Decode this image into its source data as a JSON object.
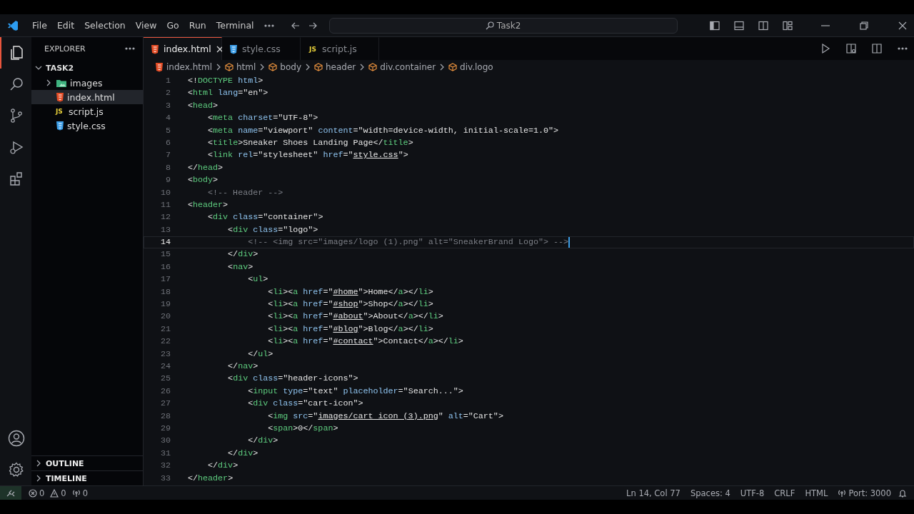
{
  "title_bar": {
    "menu": [
      "File",
      "Edit",
      "Selection",
      "View",
      "Go",
      "Run",
      "Terminal"
    ],
    "search": {
      "value": "Task2"
    }
  },
  "activity_bar": [
    {
      "kind": "files",
      "selected": true
    },
    {
      "kind": "search",
      "selected": false
    },
    {
      "kind": "source-control",
      "selected": false
    },
    {
      "kind": "run",
      "selected": false
    },
    {
      "kind": "extensions",
      "selected": false
    }
  ],
  "sidebar": {
    "title": "EXPLORER",
    "folder": {
      "label": "TASK2",
      "expanded": true
    },
    "items": [
      {
        "label": "images",
        "kind": "folder",
        "expanded": false,
        "selected": false
      },
      {
        "label": "index.html",
        "kind": "html",
        "selected": true
      },
      {
        "label": "script.js",
        "kind": "js",
        "icon_text": "JS",
        "selected": false
      },
      {
        "label": "style.css",
        "kind": "css",
        "selected": false
      }
    ],
    "sections": [
      "OUTLINE",
      "TIMELINE"
    ]
  },
  "tabs": [
    {
      "label": "index.html",
      "kind": "html",
      "selected": true
    },
    {
      "label": "style.css",
      "kind": "css",
      "selected": false
    },
    {
      "label": "script.js",
      "kind": "js",
      "icon_text": "JS",
      "selected": false
    }
  ],
  "breadcrumbs": [
    {
      "label": "index.html",
      "kind": "file"
    },
    {
      "label": "html",
      "kind": "element"
    },
    {
      "label": "body",
      "kind": "element"
    },
    {
      "label": "header",
      "kind": "element"
    },
    {
      "label": "div.container",
      "kind": "element"
    },
    {
      "label": "div.logo",
      "kind": "element"
    }
  ],
  "code": [
    {
      "number": "1",
      "current": false,
      "tokens": [
        {
          "kind": "plain",
          "text": "<!"
        },
        {
          "kind": "tag",
          "text": "DOCTYPE "
        },
        {
          "kind": "attr",
          "text": "html"
        },
        {
          "kind": "plain",
          "text": ">"
        }
      ]
    },
    {
      "number": "2",
      "current": false,
      "tokens": [
        {
          "kind": "plain",
          "text": "<"
        },
        {
          "kind": "tag",
          "text": "html "
        },
        {
          "kind": "attr",
          "text": "lang"
        },
        {
          "kind": "plain",
          "text": "=\"en\">"
        }
      ]
    },
    {
      "number": "3",
      "current": false,
      "tokens": [
        {
          "kind": "plain",
          "text": "<"
        },
        {
          "kind": "tag",
          "text": "head"
        },
        {
          "kind": "plain",
          "text": ">"
        }
      ]
    },
    {
      "number": "4",
      "current": false,
      "tokens": [
        {
          "kind": "plain",
          "text": "    <"
        },
        {
          "kind": "tag",
          "text": "meta "
        },
        {
          "kind": "attr",
          "text": "charset"
        },
        {
          "kind": "plain",
          "text": "=\"UTF-8\">"
        }
      ]
    },
    {
      "number": "5",
      "current": false,
      "tokens": [
        {
          "kind": "plain",
          "text": "    <"
        },
        {
          "kind": "tag",
          "text": "meta "
        },
        {
          "kind": "attr",
          "text": "name"
        },
        {
          "kind": "plain",
          "text": "=\"viewport\" "
        },
        {
          "kind": "attr",
          "text": "content"
        },
        {
          "kind": "plain",
          "text": "=\"width=device-width, initial-scale=1.0\">"
        }
      ]
    },
    {
      "number": "6",
      "current": false,
      "tokens": [
        {
          "kind": "plain",
          "text": "    <"
        },
        {
          "kind": "tag",
          "text": "title"
        },
        {
          "kind": "plain",
          "text": ">Sneaker Shoes Landing Page</"
        },
        {
          "kind": "tag",
          "text": "title"
        },
        {
          "kind": "plain",
          "text": ">"
        }
      ]
    },
    {
      "number": "7",
      "current": false,
      "tokens": [
        {
          "kind": "plain",
          "text": "    <"
        },
        {
          "kind": "tag",
          "text": "link "
        },
        {
          "kind": "attr",
          "text": "rel"
        },
        {
          "kind": "plain",
          "text": "=\"stylesheet\" "
        },
        {
          "kind": "attr",
          "text": "href"
        },
        {
          "kind": "plain",
          "text": "=\""
        },
        {
          "kind": "link",
          "text": "style.css"
        },
        {
          "kind": "plain",
          "text": "\">"
        }
      ]
    },
    {
      "number": "8",
      "current": false,
      "tokens": [
        {
          "kind": "plain",
          "text": "</"
        },
        {
          "kind": "tag",
          "text": "head"
        },
        {
          "kind": "plain",
          "text": ">"
        }
      ]
    },
    {
      "number": "9",
      "current": false,
      "tokens": [
        {
          "kind": "plain",
          "text": "<"
        },
        {
          "kind": "tag",
          "text": "body"
        },
        {
          "kind": "plain",
          "text": ">"
        }
      ]
    },
    {
      "number": "10",
      "current": false,
      "tokens": [
        {
          "kind": "comment",
          "text": "    <!-- Header -->"
        }
      ]
    },
    {
      "number": "11",
      "current": false,
      "tokens": [
        {
          "kind": "plain",
          "text": "<"
        },
        {
          "kind": "tag",
          "text": "header"
        },
        {
          "kind": "plain",
          "text": ">"
        }
      ]
    },
    {
      "number": "12",
      "current": false,
      "tokens": [
        {
          "kind": "plain",
          "text": "    <"
        },
        {
          "kind": "tag",
          "text": "div "
        },
        {
          "kind": "attr",
          "text": "class"
        },
        {
          "kind": "plain",
          "text": "=\"container\">"
        }
      ]
    },
    {
      "number": "13",
      "current": false,
      "tokens": [
        {
          "kind": "plain",
          "text": "        <"
        },
        {
          "kind": "tag",
          "text": "div "
        },
        {
          "kind": "attr",
          "text": "class"
        },
        {
          "kind": "plain",
          "text": "=\"logo\">"
        }
      ]
    },
    {
      "number": "14",
      "current": true,
      "tokens": [
        {
          "kind": "comment",
          "text": "            <!-- <img src=\"images/logo (1).png\" alt=\"SneakerBrand Logo\"> -->"
        }
      ]
    },
    {
      "number": "15",
      "current": false,
      "tokens": [
        {
          "kind": "plain",
          "text": "        </"
        },
        {
          "kind": "tag",
          "text": "div"
        },
        {
          "kind": "plain",
          "text": ">"
        }
      ]
    },
    {
      "number": "16",
      "current": false,
      "tokens": [
        {
          "kind": "plain",
          "text": "        <"
        },
        {
          "kind": "tag",
          "text": "nav"
        },
        {
          "kind": "plain",
          "text": ">"
        }
      ]
    },
    {
      "number": "17",
      "current": false,
      "tokens": [
        {
          "kind": "plain",
          "text": "            <"
        },
        {
          "kind": "tag",
          "text": "ul"
        },
        {
          "kind": "plain",
          "text": ">"
        }
      ]
    },
    {
      "number": "18",
      "current": false,
      "tokens": [
        {
          "kind": "plain",
          "text": "                <"
        },
        {
          "kind": "tag",
          "text": "li"
        },
        {
          "kind": "plain",
          "text": "><"
        },
        {
          "kind": "tag",
          "text": "a "
        },
        {
          "kind": "attr",
          "text": "href"
        },
        {
          "kind": "plain",
          "text": "=\""
        },
        {
          "kind": "link",
          "text": "#home"
        },
        {
          "kind": "plain",
          "text": "\">Home</"
        },
        {
          "kind": "tag",
          "text": "a"
        },
        {
          "kind": "plain",
          "text": "></"
        },
        {
          "kind": "tag",
          "text": "li"
        },
        {
          "kind": "plain",
          "text": ">"
        }
      ]
    },
    {
      "number": "19",
      "current": false,
      "tokens": [
        {
          "kind": "plain",
          "text": "                <"
        },
        {
          "kind": "tag",
          "text": "li"
        },
        {
          "kind": "plain",
          "text": "><"
        },
        {
          "kind": "tag",
          "text": "a "
        },
        {
          "kind": "attr",
          "text": "href"
        },
        {
          "kind": "plain",
          "text": "=\""
        },
        {
          "kind": "link",
          "text": "#shop"
        },
        {
          "kind": "plain",
          "text": "\">Shop</"
        },
        {
          "kind": "tag",
          "text": "a"
        },
        {
          "kind": "plain",
          "text": "></"
        },
        {
          "kind": "tag",
          "text": "li"
        },
        {
          "kind": "plain",
          "text": ">"
        }
      ]
    },
    {
      "number": "20",
      "current": false,
      "tokens": [
        {
          "kind": "plain",
          "text": "                <"
        },
        {
          "kind": "tag",
          "text": "li"
        },
        {
          "kind": "plain",
          "text": "><"
        },
        {
          "kind": "tag",
          "text": "a "
        },
        {
          "kind": "attr",
          "text": "href"
        },
        {
          "kind": "plain",
          "text": "=\""
        },
        {
          "kind": "link",
          "text": "#about"
        },
        {
          "kind": "plain",
          "text": "\">About</"
        },
        {
          "kind": "tag",
          "text": "a"
        },
        {
          "kind": "plain",
          "text": "></"
        },
        {
          "kind": "tag",
          "text": "li"
        },
        {
          "kind": "plain",
          "text": ">"
        }
      ]
    },
    {
      "number": "21",
      "current": false,
      "tokens": [
        {
          "kind": "plain",
          "text": "                <"
        },
        {
          "kind": "tag",
          "text": "li"
        },
        {
          "kind": "plain",
          "text": "><"
        },
        {
          "kind": "tag",
          "text": "a "
        },
        {
          "kind": "attr",
          "text": "href"
        },
        {
          "kind": "plain",
          "text": "=\""
        },
        {
          "kind": "link",
          "text": "#blog"
        },
        {
          "kind": "plain",
          "text": "\">Blog</"
        },
        {
          "kind": "tag",
          "text": "a"
        },
        {
          "kind": "plain",
          "text": "></"
        },
        {
          "kind": "tag",
          "text": "li"
        },
        {
          "kind": "plain",
          "text": ">"
        }
      ]
    },
    {
      "number": "22",
      "current": false,
      "tokens": [
        {
          "kind": "plain",
          "text": "                <"
        },
        {
          "kind": "tag",
          "text": "li"
        },
        {
          "kind": "plain",
          "text": "><"
        },
        {
          "kind": "tag",
          "text": "a "
        },
        {
          "kind": "attr",
          "text": "href"
        },
        {
          "kind": "plain",
          "text": "=\""
        },
        {
          "kind": "link",
          "text": "#contact"
        },
        {
          "kind": "plain",
          "text": "\">Contact</"
        },
        {
          "kind": "tag",
          "text": "a"
        },
        {
          "kind": "plain",
          "text": "></"
        },
        {
          "kind": "tag",
          "text": "li"
        },
        {
          "kind": "plain",
          "text": ">"
        }
      ]
    },
    {
      "number": "23",
      "current": false,
      "tokens": [
        {
          "kind": "plain",
          "text": "            </"
        },
        {
          "kind": "tag",
          "text": "ul"
        },
        {
          "kind": "plain",
          "text": ">"
        }
      ]
    },
    {
      "number": "24",
      "current": false,
      "tokens": [
        {
          "kind": "plain",
          "text": "        </"
        },
        {
          "kind": "tag",
          "text": "nav"
        },
        {
          "kind": "plain",
          "text": ">"
        }
      ]
    },
    {
      "number": "25",
      "current": false,
      "tokens": [
        {
          "kind": "plain",
          "text": "        <"
        },
        {
          "kind": "tag",
          "text": "div "
        },
        {
          "kind": "attr",
          "text": "class"
        },
        {
          "kind": "plain",
          "text": "=\"header-icons\">"
        }
      ]
    },
    {
      "number": "26",
      "current": false,
      "tokens": [
        {
          "kind": "plain",
          "text": "            <"
        },
        {
          "kind": "tag",
          "text": "input "
        },
        {
          "kind": "attr",
          "text": "type"
        },
        {
          "kind": "plain",
          "text": "=\"text\" "
        },
        {
          "kind": "attr",
          "text": "placeholder"
        },
        {
          "kind": "plain",
          "text": "=\"Search...\">"
        }
      ]
    },
    {
      "number": "27",
      "current": false,
      "tokens": [
        {
          "kind": "plain",
          "text": "            <"
        },
        {
          "kind": "tag",
          "text": "div "
        },
        {
          "kind": "attr",
          "text": "class"
        },
        {
          "kind": "plain",
          "text": "=\"cart-icon\">"
        }
      ]
    },
    {
      "number": "28",
      "current": false,
      "tokens": [
        {
          "kind": "plain",
          "text": "                <"
        },
        {
          "kind": "tag",
          "text": "img "
        },
        {
          "kind": "attr",
          "text": "src"
        },
        {
          "kind": "plain",
          "text": "=\""
        },
        {
          "kind": "link",
          "text": "images/cart icon (3).png"
        },
        {
          "kind": "plain",
          "text": "\" "
        },
        {
          "kind": "attr",
          "text": "alt"
        },
        {
          "kind": "plain",
          "text": "=\"Cart\">"
        }
      ]
    },
    {
      "number": "29",
      "current": false,
      "tokens": [
        {
          "kind": "plain",
          "text": "                <"
        },
        {
          "kind": "tag",
          "text": "span"
        },
        {
          "kind": "plain",
          "text": ">0</"
        },
        {
          "kind": "tag",
          "text": "span"
        },
        {
          "kind": "plain",
          "text": ">"
        }
      ]
    },
    {
      "number": "30",
      "current": false,
      "tokens": [
        {
          "kind": "plain",
          "text": "            </"
        },
        {
          "kind": "tag",
          "text": "div"
        },
        {
          "kind": "plain",
          "text": ">"
        }
      ]
    },
    {
      "number": "31",
      "current": false,
      "tokens": [
        {
          "kind": "plain",
          "text": "        </"
        },
        {
          "kind": "tag",
          "text": "div"
        },
        {
          "kind": "plain",
          "text": ">"
        }
      ]
    },
    {
      "number": "32",
      "current": false,
      "tokens": [
        {
          "kind": "plain",
          "text": "    </"
        },
        {
          "kind": "tag",
          "text": "div"
        },
        {
          "kind": "plain",
          "text": ">"
        }
      ]
    },
    {
      "number": "33",
      "current": false,
      "tokens": [
        {
          "kind": "plain",
          "text": "</"
        },
        {
          "kind": "tag",
          "text": "header"
        },
        {
          "kind": "plain",
          "text": ">"
        }
      ]
    }
  ],
  "status_bar": {
    "left": [
      {
        "kind": "error",
        "text": "0"
      },
      {
        "kind": "warning",
        "text": "0"
      },
      {
        "kind": "ports",
        "text": "0"
      }
    ],
    "right": [
      {
        "kind": "text",
        "text": "Ln 14, Col 77"
      },
      {
        "kind": "text",
        "text": "Spaces: 4"
      },
      {
        "kind": "text",
        "text": "UTF-8"
      },
      {
        "kind": "text",
        "text": "CRLF"
      },
      {
        "kind": "text",
        "text": "HTML"
      },
      {
        "kind": "port",
        "text": "Port: 3000"
      }
    ]
  }
}
